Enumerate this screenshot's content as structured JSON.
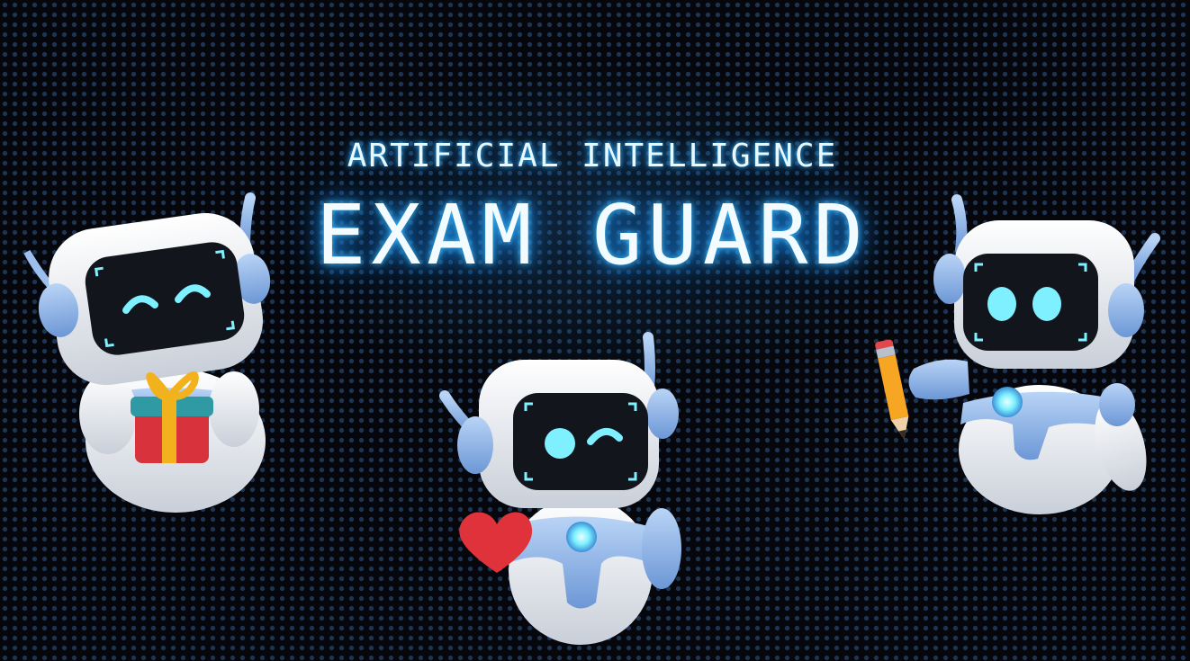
{
  "header": {
    "subtitle": "ARTIFICIAL INTELLIGENCE",
    "title": "EXAM GUARD"
  },
  "colors": {
    "background": "#05070c",
    "dot": "#1d3552",
    "glow": "#3fc0ff",
    "robot_white": "#f2f4f8",
    "robot_blue": "#8fb8ee",
    "visor": "#12151c",
    "eye": "#7ef0ff"
  },
  "illustrations": [
    {
      "name": "robot-with-gift",
      "prop": "gift-box-icon"
    },
    {
      "name": "robot-with-heart",
      "prop": "heart-icon"
    },
    {
      "name": "robot-with-pencil",
      "prop": "pencil-icon"
    }
  ]
}
